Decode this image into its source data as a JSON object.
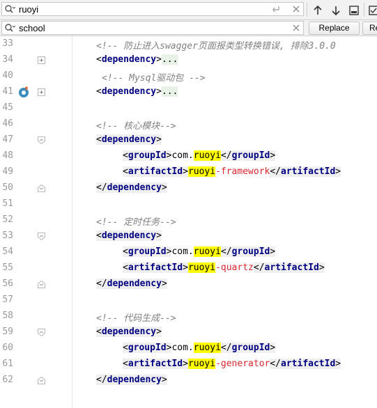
{
  "find": {
    "query": "ruoyi",
    "search_icon": "search-icon",
    "regex_icon": "enter-return-icon",
    "clear_icon": "close-icon"
  },
  "replace": {
    "query": "school",
    "search_icon": "search-icon",
    "clear_icon": "close-icon",
    "replace_label": "Replace",
    "replace_all_label": "Re"
  },
  "toolbar": {
    "prev_icon": "arrow-up-icon",
    "next_icon": "arrow-down-icon",
    "select_icon": "select-occurrences-icon",
    "settings_icon": "checkbox-icon"
  },
  "editor": {
    "lines": [
      {
        "n": "33",
        "kind": "comment",
        "text": "<!-- 防止进入swagger页面报类型转换错误, 排除3.0.0"
      },
      {
        "n": "34",
        "kind": "folded",
        "text": "dependency"
      },
      {
        "n": "40",
        "kind": "comment",
        "text": "<!-- Mysql驱动包 -->"
      },
      {
        "n": "41",
        "kind": "folded",
        "text": "dependency"
      },
      {
        "n": "45",
        "kind": "blank"
      },
      {
        "n": "46",
        "kind": "comment",
        "text": "<!-- 核心模块-->"
      },
      {
        "n": "47",
        "kind": "open",
        "tag": "dependency"
      },
      {
        "n": "48",
        "kind": "group",
        "prefix": "com.",
        "hl": "ruoyi"
      },
      {
        "n": "49",
        "kind": "artifact",
        "hl": "ruoyi",
        "suffix": "-framework"
      },
      {
        "n": "50",
        "kind": "close",
        "tag": "dependency"
      },
      {
        "n": "51",
        "kind": "blank"
      },
      {
        "n": "52",
        "kind": "comment",
        "text": "<!-- 定时任务-->"
      },
      {
        "n": "53",
        "kind": "open",
        "tag": "dependency"
      },
      {
        "n": "54",
        "kind": "group",
        "prefix": "com.",
        "hl": "ruoyi"
      },
      {
        "n": "55",
        "kind": "artifact",
        "hl": "ruoyi",
        "suffix": "-quartz"
      },
      {
        "n": "56",
        "kind": "close",
        "tag": "dependency"
      },
      {
        "n": "57",
        "kind": "blank"
      },
      {
        "n": "58",
        "kind": "comment",
        "text": "<!-- 代码生成-->"
      },
      {
        "n": "59",
        "kind": "open",
        "tag": "dependency"
      },
      {
        "n": "60",
        "kind": "group",
        "prefix": "com.",
        "hl": "ruoyi"
      },
      {
        "n": "61",
        "kind": "artifact",
        "hl": "ruoyi",
        "suffix": "-generator"
      },
      {
        "n": "62",
        "kind": "close",
        "tag": "dependency"
      }
    ],
    "tags": {
      "group": "groupId",
      "artifact": "artifactId",
      "dependency": "dependency"
    },
    "folded_placeholder": "...",
    "bookmark_icon": "override-gutter-icon"
  }
}
